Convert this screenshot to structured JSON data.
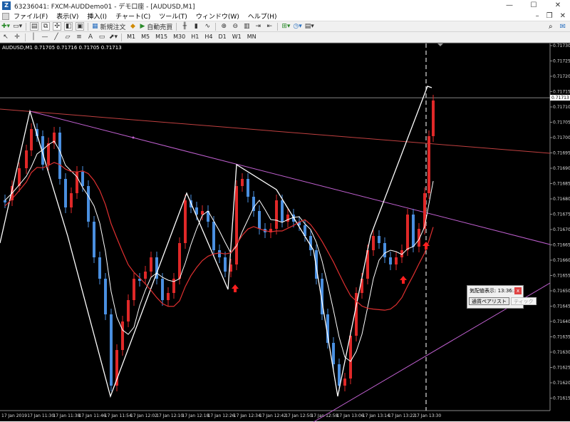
{
  "window": {
    "title": "63236041: FXCM-AUDDemo01 - デモ口座 - [AUDUSD,M1]",
    "minimize": "—",
    "maximize": "☐",
    "close": "✕"
  },
  "menu": [
    "ファイル(F)",
    "表示(V)",
    "挿入(I)",
    "チャート(C)",
    "ツール(T)",
    "ウィンドウ(W)",
    "ヘルプ(H)"
  ],
  "toolbar1": {
    "new_order": "新規注文",
    "auto_trade": "自動売買",
    "search_icon": "search-icon",
    "chat_icon": "chat-icon"
  },
  "toolbar2": {
    "timeframes": [
      "M1",
      "M5",
      "M15",
      "M30",
      "H1",
      "H4",
      "D1",
      "W1",
      "MN"
    ]
  },
  "chart": {
    "symbol_label": "AUDUSD,M1  0.71705 0.71716 0.71705 0.71713",
    "current_price": "0.71713",
    "price_labels": [
      "0.71730",
      "0.71725",
      "0.71720",
      "0.71715",
      "0.71710",
      "0.71705",
      "0.71700",
      "0.71695",
      "0.71690",
      "0.71685",
      "0.71680",
      "0.71675",
      "0.71670",
      "0.71665",
      "0.71660",
      "0.71655",
      "0.71650",
      "0.71645",
      "0.71640",
      "0.71635",
      "0.71630",
      "0.71625",
      "0.71620",
      "0.71615"
    ],
    "time_labels": [
      "17 Jan 2019",
      "17 Jan 11:30",
      "17 Jan 11:38",
      "17 Jan 11:46",
      "17 Jan 11:54",
      "17 Jan 12:02",
      "17 Jan 12:10",
      "17 Jan 12:18",
      "17 Jan 12:26",
      "17 Jan 12:34",
      "17 Jan 12:42",
      "17 Jan 12:50",
      "17 Jan 12:58",
      "17 Jan 13:06",
      "17 Jan 13:14",
      "17 Jan 13:22",
      "17 Jan 13:30"
    ],
    "colors": {
      "background": "#000000",
      "bull": "#e02828",
      "bear": "#4a8fe0",
      "white_line": "#ffffff",
      "ma_red": "#e03030",
      "trend_magenta": "#c060d0",
      "trend_red": "#c04040"
    }
  },
  "dialog": {
    "label": "気配値表示: 13:36:29",
    "btn_pairs": "通貨ペアリスト",
    "btn_tick": "ティック"
  }
}
